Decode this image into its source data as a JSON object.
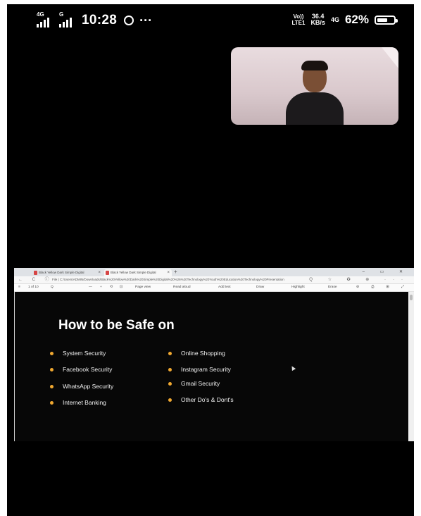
{
  "status_bar": {
    "sim1_tag": "4G",
    "sim2_tag": "G",
    "time": "10:28",
    "whatsapp_icon": "whatsapp-icon",
    "more_dots": "···",
    "volte_line1": "Vo))",
    "volte_line2": "LTE1",
    "speed_value": "36.4",
    "speed_unit": "KB/s",
    "network_4g": "4G",
    "battery_percent": "62%",
    "battery_level": 0.62
  },
  "video_call": {
    "pip_label": "video-feed"
  },
  "shared_screen": {
    "browser": {
      "tabs": [
        {
          "label": "Black Yellow Dark Simple Digital",
          "active": false
        },
        {
          "label": "Black Yellow Dark Simple Digital",
          "active": true
        }
      ],
      "new_tab": "+",
      "window_controls": "– ▭ ✕",
      "nav_icons": "← C ⓘ",
      "file_prefix": "File |",
      "url": "C:/Users/ADMIN/Downloads/Black%20Yellow%20Dark%20Simple%20Digital%20%26%20Technology%20Youth%20Education%20Technology%20Presentation",
      "right_icons": "Q ☆ ✪ ⊕ ···",
      "pdf_toolbar": {
        "menu_icon": "≡",
        "page": "1 of 10",
        "search": "Q",
        "zoom_out": "—",
        "zoom_in": "+",
        "rotate": "⟲",
        "fit": "⊡",
        "page_view": "Page view",
        "read_aloud": "Read aloud",
        "add_text": "Add text",
        "draw": "Draw",
        "highlight": "Highlight",
        "erase": "Erase",
        "right_tools": "⊘ ⎙ ⊞ ⤢ ⚙"
      }
    },
    "slide": {
      "title": "How to be Safe on",
      "left_items": [
        "System Security",
        "Facebook Security",
        "WhatsApp Security",
        "Internet Banking"
      ],
      "right_items": [
        "Online Shopping",
        "Instagram Security",
        "Gmail Security",
        "Other Do's & Dont's"
      ],
      "bullet_color": "#f0a830"
    }
  }
}
